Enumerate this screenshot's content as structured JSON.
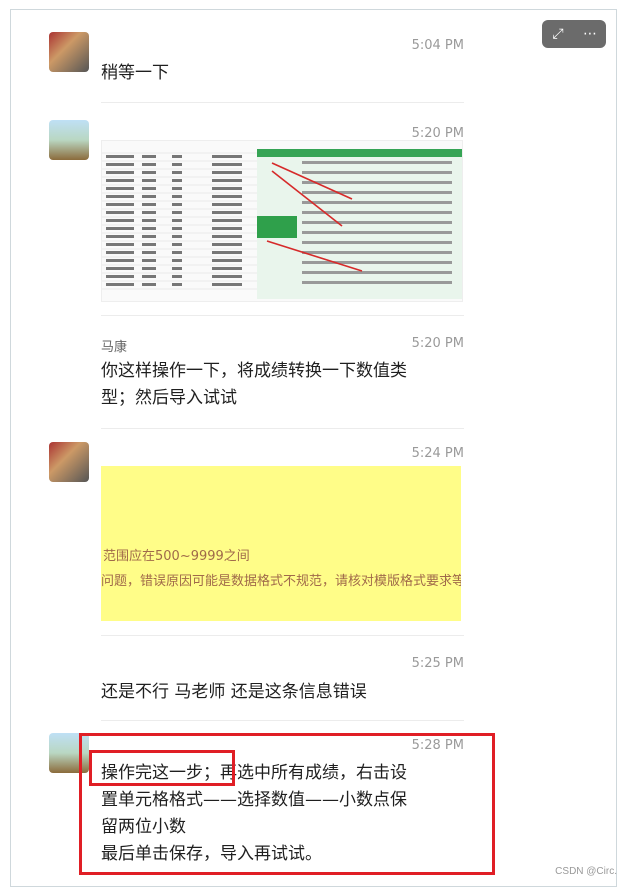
{
  "toolbar": {
    "expand_icon": "expand-icon",
    "more_icon": "more-icon"
  },
  "messages": [
    {
      "name": "",
      "time": "5:04 PM",
      "text": "稍等一下"
    },
    {
      "name": "",
      "time": "5:20 PM"
    },
    {
      "name": "马康",
      "time": "5:20 PM",
      "text": "你这样操作一下，将成绩转换一下数值类\n型；然后导入试试"
    },
    {
      "name": "",
      "time": "5:24 PM",
      "image_text_1": "范围应在500~9999之间",
      "image_text_2": "问题，错误原因可能是数据格式不规范，请核对模版格式要求等"
    },
    {
      "name": "",
      "time": "5:25 PM",
      "text": "还是不行 马老师 还是这条信息错误"
    },
    {
      "name": "",
      "time": "5:28 PM",
      "text": "操作完这一步；再选中所有成绩，右击设\n置单元格格式——选择数值——小数点保\n留两位小数\n最后单击保存，导入再试试。"
    }
  ],
  "watermark": "CSDN @Circ."
}
